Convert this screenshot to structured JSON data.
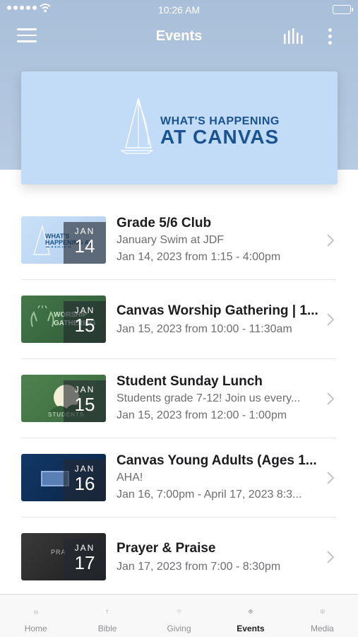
{
  "status_bar": {
    "time": "10:26 AM"
  },
  "nav": {
    "title": "Events"
  },
  "banner": {
    "line1": "WHAT'S HAPPENING",
    "line2": "AT CANVAS"
  },
  "events": [
    {
      "title": "Grade 5/6 Club",
      "subtitle": "January Swim at JDF",
      "when": "Jan 14, 2023 from 1:15 - 4:00pm",
      "month": "JAN",
      "day": "14",
      "thumb_bg": "#c2dbf6",
      "thumb_text": "WHAT'S HAPPENING AT CANVAS"
    },
    {
      "title": "Canvas Worship Gathering | 1...",
      "subtitle": "",
      "when": "Jan 15, 2023 from 10:00 - 11:30am",
      "month": "JAN",
      "day": "15",
      "thumb_bg": "#3d6b3f",
      "thumb_text": "WORSHIP GATHERING"
    },
    {
      "title": "Student Sunday Lunch",
      "subtitle": "Students grade 7-12! Join us every...",
      "when": "Jan 15, 2023 from 12:00 - 1:00pm",
      "month": "JAN",
      "day": "15",
      "thumb_bg": "#4a7a49",
      "thumb_text": "STUDENTS"
    },
    {
      "title": "Canvas Young Adults (Ages 1...",
      "subtitle": "AHA!",
      "when": "Jan 16, 7:00pm - April 17, 2023 8:3...",
      "month": "JAN",
      "day": "16",
      "thumb_bg": "#0f2e57",
      "thumb_text": ""
    },
    {
      "title": "Prayer & Praise",
      "subtitle": "",
      "when": "Jan 17, 2023 from 7:00 - 8:30pm",
      "month": "JAN",
      "day": "17",
      "thumb_bg": "#2b2b2b",
      "thumb_text": "PRA"
    }
  ],
  "tabs": [
    {
      "label": "Home",
      "icon": "home-icon",
      "active": false
    },
    {
      "label": "Bible",
      "icon": "cross-icon",
      "active": false
    },
    {
      "label": "Giving",
      "icon": "heart-icon",
      "active": false
    },
    {
      "label": "Events",
      "icon": "clock-icon",
      "active": true
    },
    {
      "label": "Media",
      "icon": "play-screen-icon",
      "active": false
    }
  ]
}
